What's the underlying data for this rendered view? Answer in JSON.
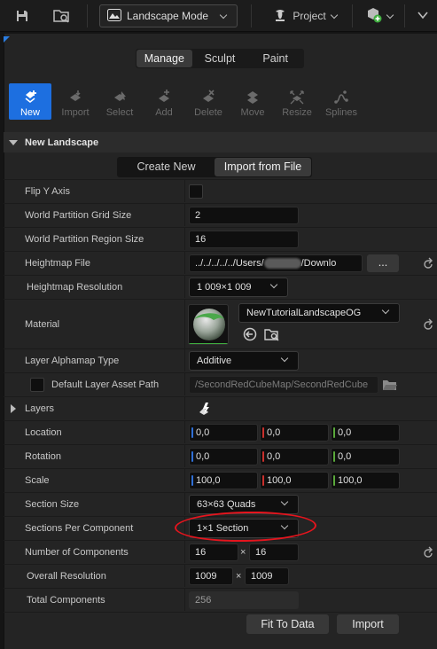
{
  "toolbar": {
    "mode_label": "Landscape Mode",
    "project_label": "Project"
  },
  "mode_tabs": [
    {
      "label": "Manage",
      "active": true
    },
    {
      "label": "Sculpt",
      "active": false
    },
    {
      "label": "Paint",
      "active": false
    }
  ],
  "tools": [
    {
      "label": "New",
      "active": true
    },
    {
      "label": "Import",
      "active": false
    },
    {
      "label": "Select",
      "active": false
    },
    {
      "label": "Add",
      "active": false
    },
    {
      "label": "Delete",
      "active": false
    },
    {
      "label": "Move",
      "active": false
    },
    {
      "label": "Resize",
      "active": false
    },
    {
      "label": "Splines",
      "active": false
    }
  ],
  "section_title": "New Landscape",
  "create_mode": {
    "create_new": "Create New",
    "import_from_file": "Import from File",
    "active": "Import from File"
  },
  "props": {
    "flip_y": {
      "label": "Flip Y Axis"
    },
    "wp_grid": {
      "label": "World Partition Grid Size",
      "value": "2"
    },
    "wp_region": {
      "label": "World Partition Region Size",
      "value": "16"
    },
    "heightmap_file": {
      "label": "Heightmap File",
      "value": "../../../../../Users/",
      "value_tail": "/Downlo",
      "browse": "..."
    },
    "heightmap_res": {
      "label": "Heightmap Resolution",
      "value": "1 009×1 009"
    },
    "material": {
      "label": "Material",
      "value": "NewTutorialLandscapeOG"
    },
    "alphamap": {
      "label": "Layer Alphamap Type",
      "value": "Additive"
    },
    "default_layer": {
      "label": "Default Layer Asset Path",
      "value": "/SecondRedCubeMap/SecondRedCube"
    },
    "layers": {
      "label": "Layers"
    },
    "location": {
      "label": "Location",
      "x": "0,0",
      "y": "0,0",
      "z": "0,0"
    },
    "rotation": {
      "label": "Rotation",
      "x": "0,0",
      "y": "0,0",
      "z": "0,0"
    },
    "scale": {
      "label": "Scale",
      "x": "100,0",
      "y": "100,0",
      "z": "100,0"
    },
    "section_size": {
      "label": "Section Size",
      "value": "63×63 Quads"
    },
    "sections_per_comp": {
      "label": "Sections Per Component",
      "value": "1×1 Section"
    },
    "num_components": {
      "label": "Number of Components",
      "x": "16",
      "sep": "×",
      "y": "16"
    },
    "overall_res": {
      "label": "Overall Resolution",
      "x": "1009",
      "sep": "×",
      "y": "1009"
    },
    "total_components": {
      "label": "Total Components",
      "value": "256"
    }
  },
  "actions": {
    "fit_to_data": "Fit To Data",
    "import": "Import"
  },
  "colors": {
    "accent": "#1d6fe0",
    "axis_x": "#2f6fd6",
    "axis_y": "#c9302c",
    "axis_z": "#5aa83a",
    "annotation": "#e5141d"
  }
}
